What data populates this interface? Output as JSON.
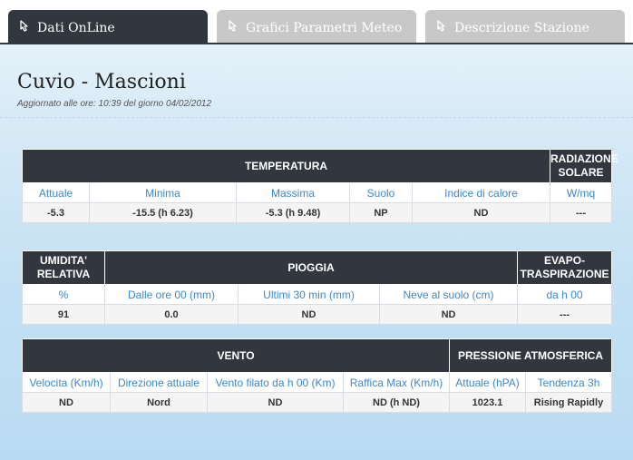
{
  "tabs": [
    {
      "label": "Dati OnLine"
    },
    {
      "label": "Grafici Parametri Meteo"
    },
    {
      "label": "Descrizione Stazione"
    }
  ],
  "station": {
    "title": "Cuvio - Mascioni",
    "updated": "Aggiornato alle ore: 10:39 del giorno 04/02/2012"
  },
  "temperatura": {
    "header": "TEMPERATURA",
    "radiazione_header": "RADIAZIONE SOLARE",
    "labels": [
      "Attuale",
      "Minima",
      "Massima",
      "Suolo",
      "Indice di calore",
      "W/mq"
    ],
    "values": [
      "-5.3",
      "-15.5 (h 6.23)",
      "-5.3 (h 9.48)",
      "NP",
      "ND",
      "---"
    ]
  },
  "pioggia": {
    "umidita_header": "UMIDITA' RELATIVA",
    "header": "PIOGGIA",
    "evapo_header": "EVAPO-TRASPIRAZIONE",
    "labels": [
      "%",
      "Dalle ore 00 (mm)",
      "Ultimi 30 min (mm)",
      "Neve al suolo (cm)",
      "da h 00"
    ],
    "values": [
      "91",
      "0.0",
      "ND",
      "ND",
      "---"
    ]
  },
  "vento": {
    "header": "VENTO",
    "pressione_header": "PRESSIONE ATMOSFERICA",
    "labels": [
      "Velocita (Km/h)",
      "Direzione attuale",
      "Vento filato da h 00 (Km)",
      "Raffica Max (Km/h)",
      "Attuale (hPA)",
      "Tendenza 3h"
    ],
    "values": [
      "ND",
      "Nord",
      "ND",
      "ND (h ND)",
      "1023.1",
      "Rising Rapidly"
    ]
  },
  "icons": {
    "tab": "pointer-hand-icon"
  },
  "colors": {
    "header_bg": "#31363f",
    "label_text": "#3b88c9",
    "tab_inactive": "#c8c8c8"
  }
}
